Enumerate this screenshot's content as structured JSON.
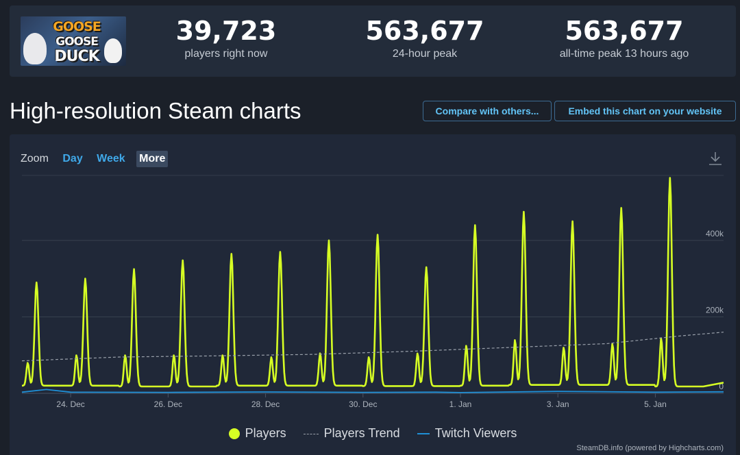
{
  "game": {
    "logo_line1": "GOOSE",
    "logo_line2": "GOOSE",
    "logo_line3": "DUCK"
  },
  "stats": [
    {
      "value": "39,723",
      "label": "players right now"
    },
    {
      "value": "563,677",
      "label": "24-hour peak"
    },
    {
      "value": "563,677",
      "label": "all-time peak 13 hours ago"
    }
  ],
  "header": {
    "title": "High-resolution Steam charts",
    "compare_label": "Compare with others...",
    "embed_label": "Embed this chart on your website"
  },
  "zoom": {
    "label": "Zoom",
    "options": [
      "Day",
      "Week",
      "More"
    ],
    "active": "More"
  },
  "legend": {
    "players": "Players",
    "trend": "Players Trend",
    "twitch": "Twitch Viewers"
  },
  "credit": "SteamDB.info (powered by Highcharts.com)",
  "colors": {
    "players": "#d7ff24",
    "trend": "#9aa1ab",
    "twitch": "#1f8fd6",
    "accent": "#62c3f5"
  },
  "chart_data": {
    "type": "line",
    "x_tick_labels": [
      "24. Dec",
      "26. Dec",
      "28. Dec",
      "30. Dec",
      "1. Jan",
      "3. Jan",
      "5. Jan"
    ],
    "y_tick_labels": [
      "0",
      "200k",
      "400k"
    ],
    "ylim": [
      0,
      570000
    ],
    "x_range_days": [
      23.0,
      37.4
    ],
    "grid": true,
    "legend_position": "bottom-center",
    "daily_cycle": {
      "day_start": [
        23.0,
        24.0,
        25.0,
        26.0,
        27.0,
        28.0,
        29.0,
        30.0,
        31.0,
        32.0,
        33.0,
        34.0,
        35.0,
        36.0
      ],
      "peak_value": [
        290000,
        300000,
        325000,
        348000,
        365000,
        370000,
        400000,
        415000,
        330000,
        440000,
        475000,
        450000,
        485000,
        563677
      ],
      "trough_value": [
        20000,
        20000,
        18000,
        18000,
        20000,
        20000,
        20000,
        19000,
        19000,
        20000,
        22000,
        22000,
        22000,
        18000
      ],
      "shoulder_value": [
        80000,
        100000,
        100000,
        100000,
        100000,
        95000,
        105000,
        95000,
        105000,
        125000,
        140000,
        120000,
        130000,
        145000
      ]
    },
    "series": [
      {
        "name": "Players",
        "description": "daily cycle, peaks listed in daily_cycle.peak_value"
      },
      {
        "name": "Players Trend",
        "x_days": [
          23.0,
          25.0,
          27.0,
          29.0,
          31.0,
          33.0,
          35.0,
          36.5,
          37.4
        ],
        "values": [
          85000,
          95000,
          98000,
          102000,
          110000,
          120000,
          130000,
          150000,
          160000
        ]
      },
      {
        "name": "Twitch Viewers",
        "x_days": [
          23.0,
          23.5,
          24.0,
          26.0,
          28.0,
          30.0,
          31.5,
          32.0,
          34.0,
          36.0,
          37.4
        ],
        "values": [
          3000,
          10000,
          3000,
          2500,
          3500,
          2500,
          3000,
          2000,
          5000,
          3000,
          4000
        ]
      }
    ]
  }
}
